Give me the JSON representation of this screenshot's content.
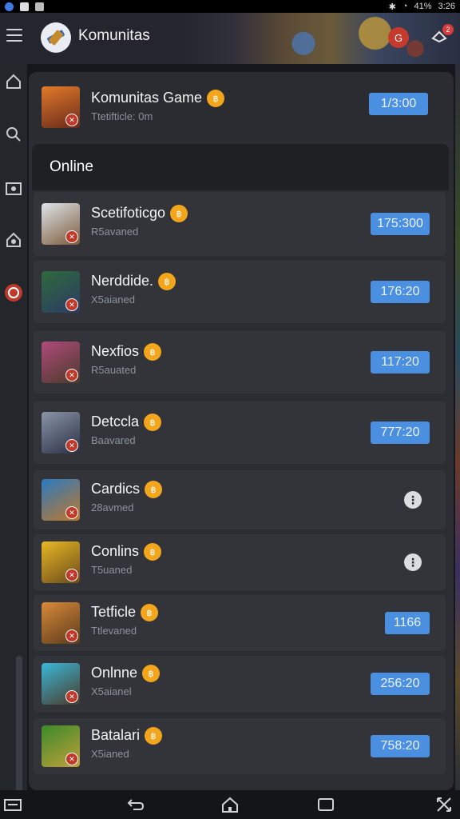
{
  "status_bar": {
    "battery": "41%",
    "time": "3:26",
    "icons": [
      "app-icon-blue",
      "notif-icon",
      "mail-icon",
      "bluetooth-icon",
      "wifi-icon",
      "signal-icon"
    ]
  },
  "header": {
    "title": "Komunitas",
    "notification_symbol": "G",
    "chat_badge": "2",
    "icons": [
      "menu-icon",
      "app-logo-icon",
      "notification-icon",
      "chat-icon"
    ]
  },
  "side_rail": {
    "icons": [
      "home-icon",
      "search-icon",
      "view-icon",
      "community-icon",
      "help-icon"
    ]
  },
  "featured": {
    "name": "Komunitas Game",
    "coin": "฿",
    "subtitle": "Ttetifticle: 0m",
    "timer": "1/3:00"
  },
  "online": {
    "title": "Online",
    "rows": [
      {
        "name": "Scetifoticgo",
        "coin": "฿",
        "subtitle": "R5avaned",
        "timer": "175:300",
        "avatar_colors": [
          "#dfe4ea",
          "#7b5a3a"
        ]
      },
      {
        "name": "Nerddide.",
        "coin": "฿",
        "subtitle": "X5aianed",
        "timer": "176:20",
        "avatar_colors": [
          "#2f6a3a",
          "#2b3a66"
        ]
      },
      {
        "name": "Nexfios",
        "coin": "฿",
        "subtitle": "R5auated",
        "timer": "117:20",
        "avatar_colors": [
          "#b04a7a",
          "#4a3a2a"
        ]
      },
      {
        "name": "Detccla",
        "coin": "฿",
        "subtitle": "Baavared",
        "timer": "777:20",
        "avatar_colors": [
          "#8a95a8",
          "#2a2f44"
        ]
      },
      {
        "name": "Cardics",
        "coin": "฿",
        "subtitle": "28avmed",
        "timer": "",
        "more": "⋮",
        "avatar_colors": [
          "#2a7ac0",
          "#c0782a"
        ]
      },
      {
        "name": "Conlins",
        "coin": "฿",
        "subtitle": "T5uaned",
        "timer": "",
        "more": "⋮",
        "avatar_colors": [
          "#e8b825",
          "#6a4a1a"
        ]
      },
      {
        "name": "Tetficle",
        "coin": "฿",
        "subtitle": "Ttlevaned",
        "timer": "1166",
        "avatar_colors": [
          "#d88a3a",
          "#5a3a1a"
        ]
      },
      {
        "name": "Onlnne",
        "coin": "฿",
        "subtitle": "X5aianel",
        "timer": "256:20",
        "avatar_colors": [
          "#3ab8d8",
          "#4a3a2a"
        ]
      },
      {
        "name": "Batalari",
        "coin": "฿",
        "subtitle": "X5ianed",
        "timer": "758:20",
        "avatar_colors": [
          "#3a8a2a",
          "#c0a03a"
        ]
      }
    ]
  },
  "bottom_nav": {
    "icons": [
      "keyboard-icon",
      "back-icon",
      "home-nav-icon",
      "recents-icon",
      "fullscreen-icon"
    ]
  },
  "colors": {
    "timer_blue": "#4b8fe0",
    "coin_orange": "#f3a51b",
    "accent_red": "#c53a2c"
  }
}
